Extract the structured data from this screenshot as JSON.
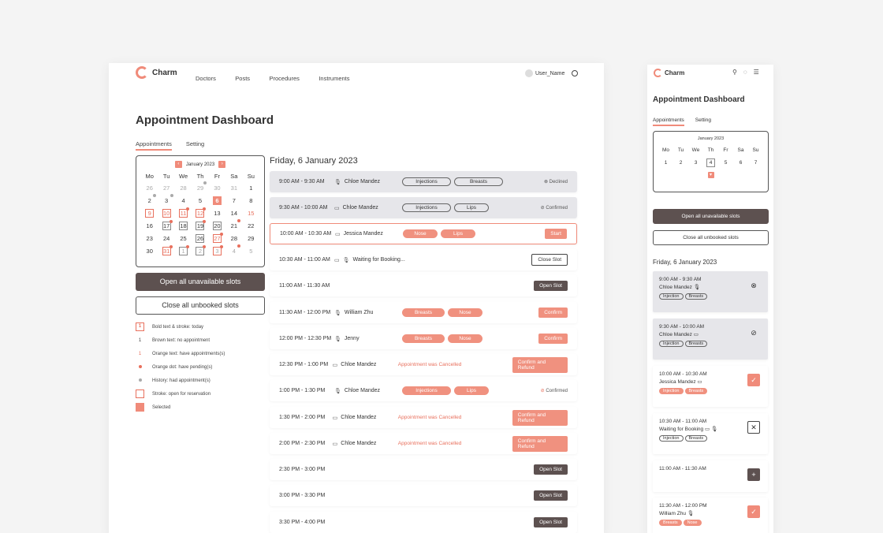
{
  "app": {
    "name": "Charm",
    "user": "User_Name"
  },
  "nav": [
    "Doctors",
    "Posts",
    "Procedures",
    "Instruments"
  ],
  "page": {
    "title": "Appointment Dashboard",
    "tabs": [
      "Appointments",
      "Setting"
    ]
  },
  "calendar": {
    "month": "January 2023",
    "weekdays": [
      "Mo",
      "Tu",
      "We",
      "Th",
      "Fr",
      "Sa",
      "Su"
    ],
    "days": [
      "26",
      "27",
      "28",
      "29",
      "30",
      "31",
      "1",
      "2",
      "3",
      "4",
      "5",
      "6",
      "7",
      "8",
      "9",
      "10",
      "11",
      "12",
      "13",
      "14",
      "15",
      "16",
      "17",
      "18",
      "19",
      "20",
      "21",
      "22",
      "23",
      "24",
      "25",
      "26",
      "27",
      "28",
      "29",
      "30",
      "31",
      "1",
      "2",
      "3",
      "4",
      "5"
    ]
  },
  "buttons": {
    "open_unavailable": "Open all unavailable slots",
    "close_unbooked": "Close all unbooked slots"
  },
  "legend": [
    "Bold text & stroke: today",
    "Brown text: no appointment",
    "Orange text: have appointments(s)",
    "Orange dot: have pending(s)",
    "History: had appointment(s)",
    "Stroke: open for reservation",
    "Selected"
  ],
  "legend_sample": {
    "today": "1",
    "brown": "1",
    "orange": "1"
  },
  "schedule": {
    "date": "Friday, 6 January 2023",
    "rows": [
      {
        "time": "9:00 AM - 9:30 AM",
        "name": "Chloe Mandez",
        "tags": [
          "Injections",
          "Breasts"
        ],
        "action": "Declined"
      },
      {
        "time": "9:30 AM - 10:00 AM",
        "name": "Chloe Mandez",
        "tags": [
          "Injections",
          "Lips"
        ],
        "action": "Confirmed"
      },
      {
        "time": "10:00 AM - 10:30 AM",
        "name": "Jessica Mandez",
        "tags": [
          "Nose",
          "Lips"
        ],
        "action": "Start"
      },
      {
        "time": "10:30 AM - 11:00 AM",
        "name": "Waiting for Booking...",
        "tags": [],
        "action": "Close Slot"
      },
      {
        "time": "11:00 AM - 11:30 AM",
        "name": "",
        "tags": [],
        "action": "Open Slot"
      },
      {
        "time": "11:30 AM - 12:00 PM",
        "name": "William Zhu",
        "tags": [
          "Breasts",
          "Nose"
        ],
        "action": "Confirm"
      },
      {
        "time": "12:00 PM - 12:30 PM",
        "name": "Jenny",
        "tags": [
          "Breasts",
          "Nose"
        ],
        "action": "Confirm"
      },
      {
        "time": "12:30 PM - 1:00 PM",
        "name": "Chloe Mandez",
        "cancel": "Appointment was Cancelled",
        "action": "Confirm and Refund"
      },
      {
        "time": "1:00 PM - 1:30 PM",
        "name": "Chloe Mandez",
        "tags": [
          "Injections",
          "Lips"
        ],
        "action": "Confirmed"
      },
      {
        "time": "1:30 PM - 2:00 PM",
        "name": "Chloe Mandez",
        "cancel": "Appointment was Cancelled",
        "action": "Confirm and Refund"
      },
      {
        "time": "2:00 PM - 2:30 PM",
        "name": "Chloe Mandez",
        "cancel": "Appointment was Cancelled",
        "action": "Confirm and Refund"
      },
      {
        "time": "2:30 PM - 3:00 PM",
        "name": "",
        "action": "Open Slot"
      },
      {
        "time": "3:00 PM - 3:30 PM",
        "name": "",
        "action": "Open Slot"
      },
      {
        "time": "3:30 PM - 4:00 PM",
        "name": "",
        "action": "Open Slot"
      }
    ]
  },
  "mobile": {
    "month": "January 2023",
    "days": [
      "1",
      "2",
      "3",
      "4",
      "5",
      "6",
      "7"
    ],
    "open_unavailable": "Open all unavailable slots",
    "close_unbooked": "Close all unbooked slots",
    "date": "Friday, 6 January 2023",
    "cards": [
      {
        "time": "9:00 AM - 9:30 AM",
        "name": "Chloe Mandez",
        "tags": [
          "Injection",
          "Breasts"
        ]
      },
      {
        "time": "9:30 AM - 10:00 AM",
        "name": "Chloe Mandez",
        "tags": [
          "Injection",
          "Breasts"
        ]
      },
      {
        "time": "10:00 AM - 10:30 AM",
        "name": "Jessica Mandez",
        "tags": [
          "Injection",
          "Breasts"
        ]
      },
      {
        "time": "10:30 AM - 11:00 AM",
        "name": "Waiting for Booking",
        "tags": [
          "Injection",
          "Breasts"
        ]
      },
      {
        "time": "11:00 AM - 11:30 AM",
        "name": ""
      },
      {
        "time": "11:30 AM - 12:00 PM",
        "name": "William Zhu",
        "tags": [
          "Breasts",
          "Nose"
        ]
      }
    ]
  },
  "colors": {
    "accent": "#f08b7a",
    "dark": "#5d5150"
  }
}
